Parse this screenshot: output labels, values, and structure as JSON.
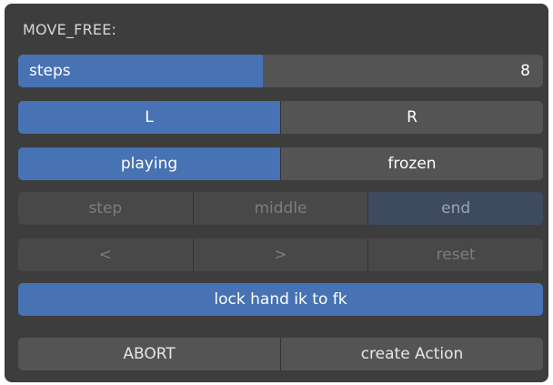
{
  "panel": {
    "title": "MOVE_FREE:"
  },
  "steps": {
    "label": "steps",
    "value": "8",
    "fill_fraction": 0.466
  },
  "side": {
    "left_label": "L",
    "right_label": "R",
    "selected": "L"
  },
  "mode": {
    "playing_label": "playing",
    "frozen_label": "frozen",
    "selected": "playing"
  },
  "position": {
    "step_label": "step",
    "middle_label": "middle",
    "end_label": "end",
    "selected": "end"
  },
  "nav": {
    "prev_label": "<",
    "next_label": ">",
    "reset_label": "reset"
  },
  "lock": {
    "label": "lock hand ik to fk"
  },
  "actions": {
    "abort_label": "ABORT",
    "create_label": "create Action"
  },
  "colors": {
    "panel_bg": "#3d3d3d",
    "accent": "#4772b3",
    "button_bg": "#545454",
    "disabled_bg": "#484848",
    "disabled_text": "#7d7d7d"
  }
}
